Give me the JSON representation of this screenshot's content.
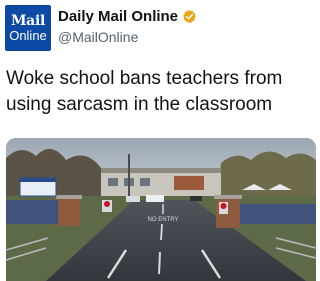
{
  "account": {
    "avatar_line1": "Mail",
    "avatar_line2": "Online",
    "display_name": "Daily Mail Online",
    "handle": "@MailOnline",
    "verified_icon": "verified-badge-icon",
    "verified_color": "#e8a317"
  },
  "tweet": {
    "text": "Woke school bans teachers from using sarcasm in the classroom"
  },
  "media": {
    "type": "photo",
    "road_marking": "NO ENTRY"
  },
  "colors": {
    "avatar_bg": "#0c4aa6",
    "text": "#0f1419",
    "secondary_text": "#536471"
  }
}
